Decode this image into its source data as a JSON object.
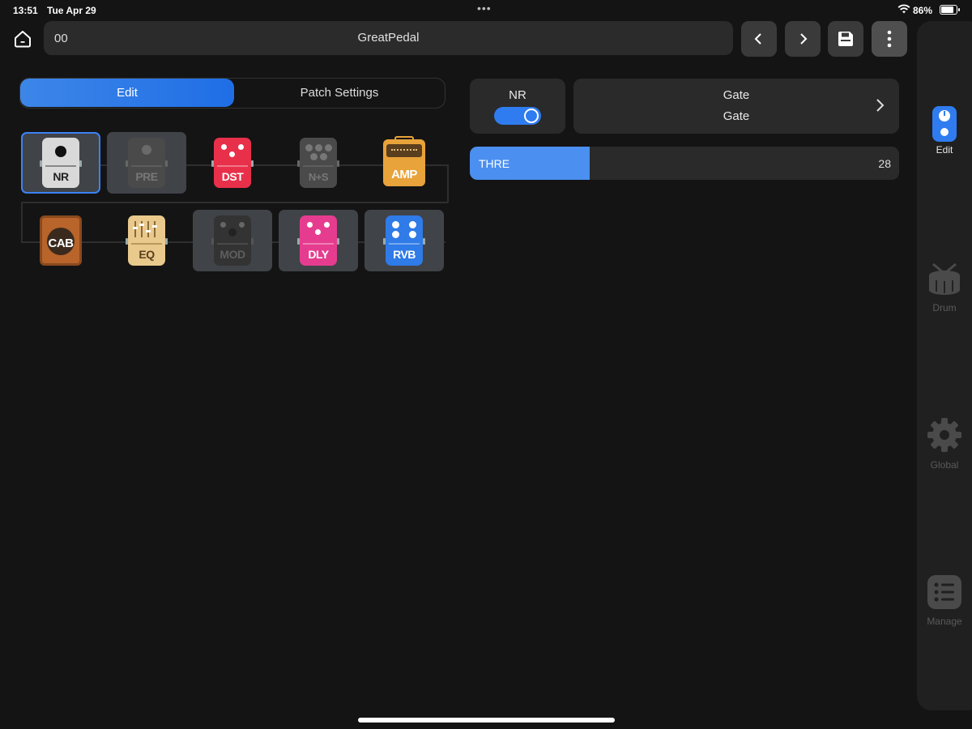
{
  "status": {
    "time": "13:51",
    "date": "Tue Apr 29",
    "battery": "86%",
    "battery_level": 0.86
  },
  "header": {
    "patch_number": "00",
    "patch_name": "GreatPedal"
  },
  "tabs": {
    "edit": "Edit",
    "patch_settings": "Patch Settings"
  },
  "effect": {
    "name": "NR",
    "enabled": true,
    "type_title": "Gate",
    "type_subtitle": "Gate"
  },
  "parameter": {
    "name": "THRE",
    "value": "28",
    "fill_fraction": 0.28
  },
  "chain": {
    "row1": [
      {
        "label": "NR",
        "kind": "nr",
        "color": "#d7d7d7"
      },
      {
        "label": "PRE",
        "kind": "pre",
        "color": "#4a4a4a"
      },
      {
        "label": "DST",
        "kind": "dst",
        "color": "#e8304a"
      },
      {
        "label": "N+S",
        "kind": "ns",
        "color": "#4a4a4a"
      },
      {
        "label": "AMP",
        "kind": "amp",
        "color": "#e8a33a"
      }
    ],
    "row2": [
      {
        "label": "CAB",
        "kind": "cab",
        "color": "#b8642a"
      },
      {
        "label": "EQ",
        "kind": "eq",
        "color": "#e9c98c"
      },
      {
        "label": "MOD",
        "kind": "mod",
        "color": "#333333"
      },
      {
        "label": "DLY",
        "kind": "dly",
        "color": "#e63c8f"
      },
      {
        "label": "RVB",
        "kind": "rvb",
        "color": "#2f7be8"
      }
    ]
  },
  "sidebar": {
    "edit": "Edit",
    "drum": "Drum",
    "global": "Global",
    "manage": "Manage"
  },
  "colors": {
    "accent": "#2f7cf0",
    "background": "#141414",
    "card": "#2a2a2a"
  }
}
